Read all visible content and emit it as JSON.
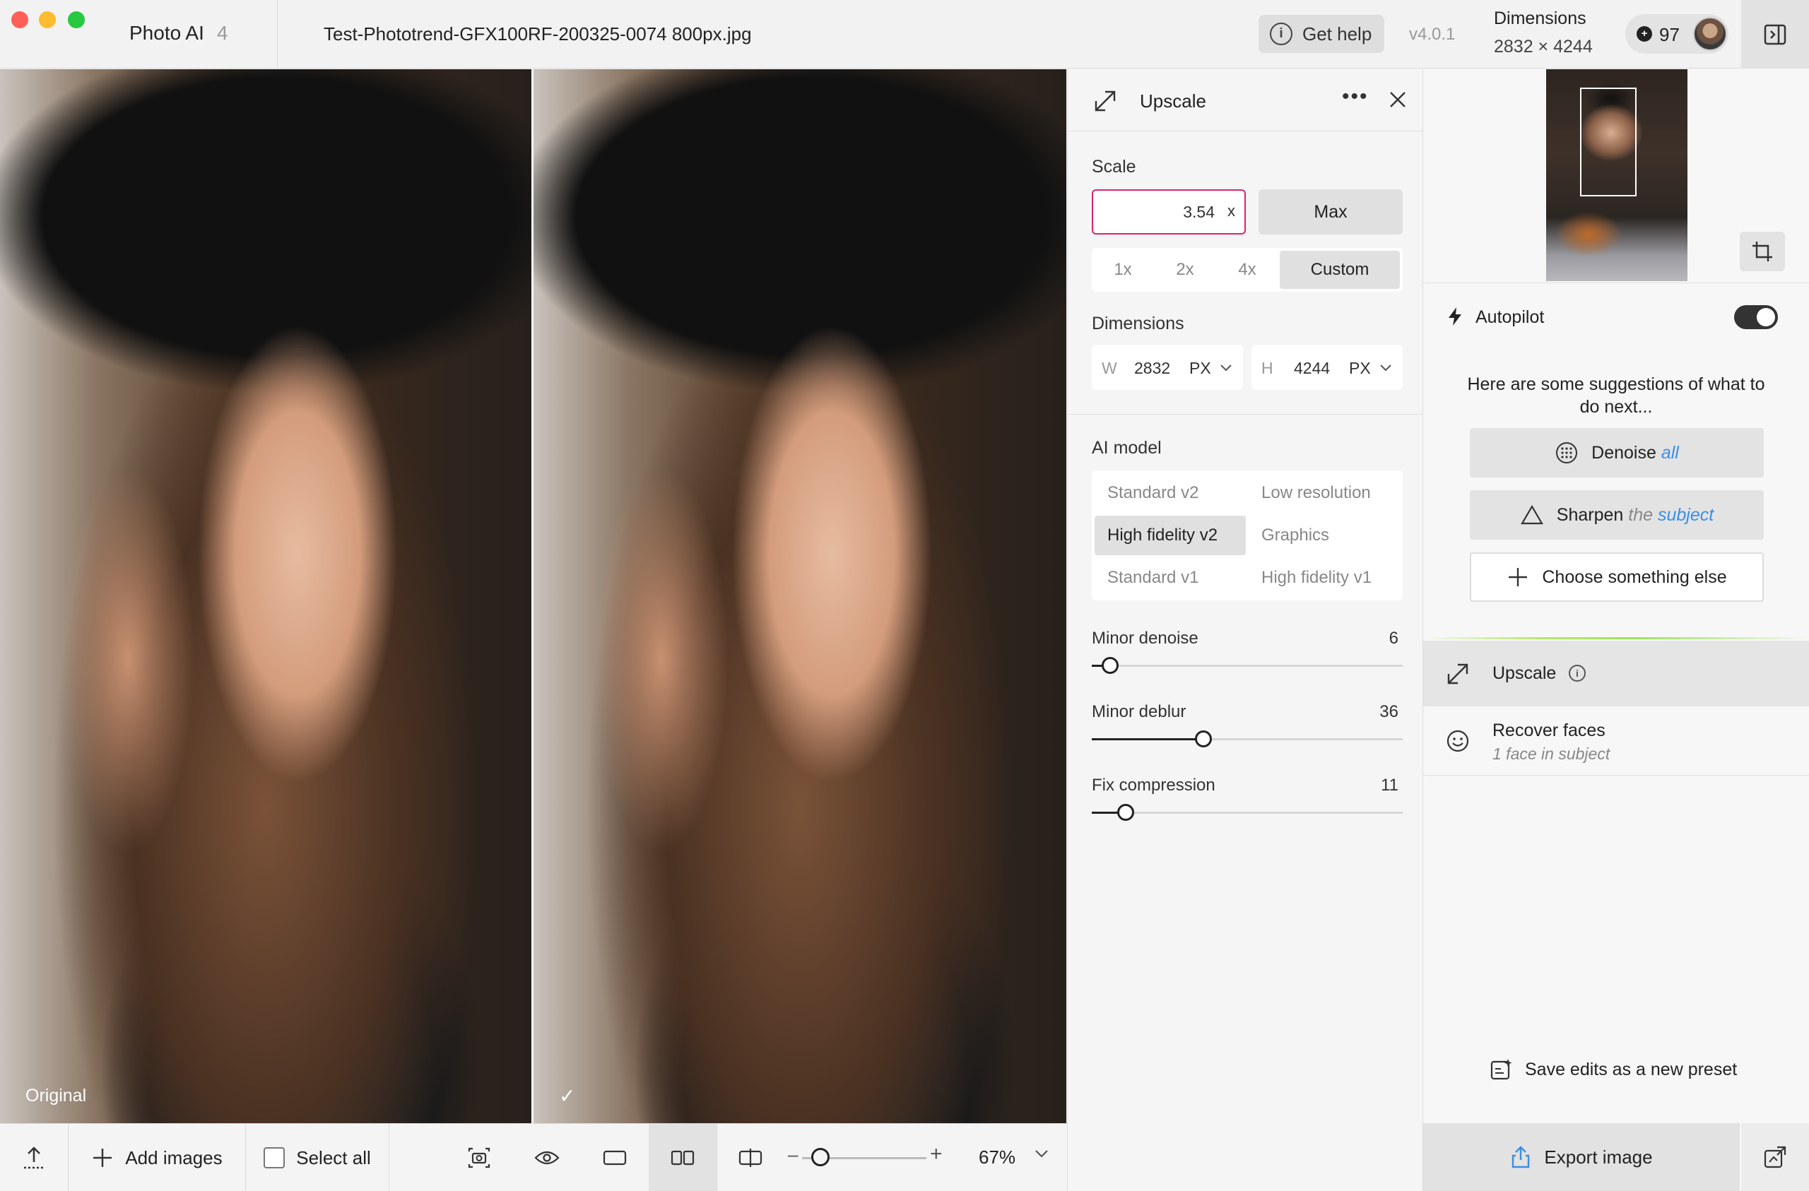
{
  "titlebar": {
    "app_name": "Photo AI",
    "app_version": "4",
    "filename": "Test-Phototrend-GFX100RF-200325-0074 800px.jpg",
    "help_label": "Get help",
    "version": "v4.0.1",
    "dimensions_label": "Dimensions",
    "dimensions_value": "2832 × 4244",
    "credits": "97"
  },
  "photos": {
    "left_tag": "Original",
    "right_tag": "✓"
  },
  "bottombar": {
    "add_images": "Add images",
    "select_all": "Select all",
    "zoom_percent": "67%",
    "zoom_level": 0.15
  },
  "upscale": {
    "title": "Upscale",
    "scale_label": "Scale",
    "scale_value": "3.54",
    "scale_suffix": "x",
    "max_label": "Max",
    "presets": [
      "1x",
      "2x",
      "4x",
      "Custom"
    ],
    "active_preset": "Custom",
    "dimensions_label": "Dimensions",
    "width_letter": "W",
    "width_value": "2832",
    "width_unit": "PX",
    "height_letter": "H",
    "height_value": "4244",
    "height_unit": "PX",
    "model_label": "AI model",
    "models": [
      "Standard v2",
      "Low resolution",
      "High fidelity v2",
      "Graphics",
      "Standard v1",
      "High fidelity v1"
    ],
    "active_model": "High fidelity v2",
    "sliders": [
      {
        "label": "Minor denoise",
        "value": 6,
        "max": 100
      },
      {
        "label": "Minor deblur",
        "value": 36,
        "max": 100
      },
      {
        "label": "Fix compression",
        "value": 11,
        "max": 100
      }
    ]
  },
  "sidebar": {
    "autopilot_label": "Autopilot",
    "autopilot_on": true,
    "suggestions_text": "Here are some suggestions of what to do next...",
    "denoise_label": "Denoise",
    "denoise_scope": "all",
    "sharpen_label": "Sharpen",
    "sharpen_mod": "the",
    "sharpen_scope": "subject",
    "choose_label": "Choose something else",
    "tools": [
      {
        "name": "Upscale",
        "sub": ""
      },
      {
        "name": "Recover faces",
        "sub": "1 face in subject"
      }
    ],
    "save_preset": "Save edits as a new preset",
    "export_label": "Export image"
  },
  "colors": {
    "accent_input_border": "#d9266a",
    "link_blue": "#3a8ee6",
    "autopilot_line": "#9be35a"
  }
}
